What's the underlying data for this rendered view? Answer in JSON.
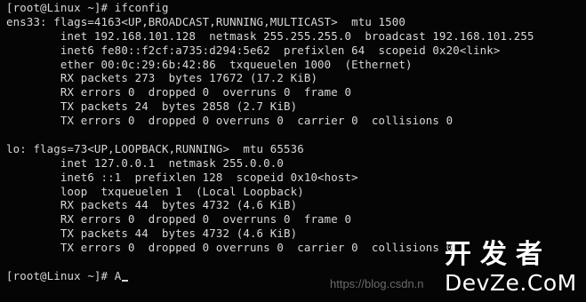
{
  "terminal": {
    "lines": [
      "[root@Linux ~]# ifconfig",
      "ens33: flags=4163<UP,BROADCAST,RUNNING,MULTICAST>  mtu 1500",
      "        inet 192.168.101.128  netmask 255.255.255.0  broadcast 192.168.101.255",
      "        inet6 fe80::f2cf:a735:d294:5e62  prefixlen 64  scopeid 0x20<link>",
      "        ether 00:0c:29:6b:42:86  txqueuelen 1000  (Ethernet)",
      "        RX packets 273  bytes 17672 (17.2 KiB)",
      "        RX errors 0  dropped 0  overruns 0  frame 0",
      "        TX packets 24  bytes 2858 (2.7 KiB)",
      "        TX errors 0  dropped 0 overruns 0  carrier 0  collisions 0",
      "",
      "lo: flags=73<UP,LOOPBACK,RUNNING>  mtu 65536",
      "        inet 127.0.0.1  netmask 255.0.0.0",
      "        inet6 ::1  prefixlen 128  scopeid 0x10<host>",
      "        loop  txqueuelen 1  (Local Loopback)",
      "        RX packets 44  bytes 4732 (4.6 KiB)",
      "        RX errors 0  dropped 0  overruns 0  frame 0",
      "        TX packets 44  bytes 4732 (4.6 KiB)",
      "        TX errors 0  dropped 0 overruns 0  carrier 0  collisions 0",
      "",
      "[root@Linux ~]# A"
    ]
  },
  "watermark": {
    "url": "https://blog.csdn.n",
    "logo_cn": "开发者",
    "logo_en": "DevZe.CoM"
  },
  "colors": {
    "background": "#050505",
    "text": "#d8d8d8"
  }
}
